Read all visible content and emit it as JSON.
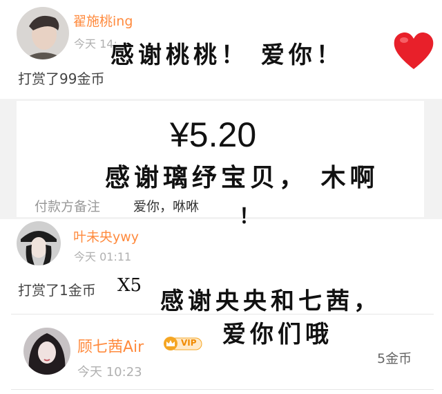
{
  "entry1": {
    "username": "翟施桃ing",
    "time": "今天 14:",
    "gift_text": "打赏了99金币",
    "caption": "感谢桃桃！ 爱你！",
    "heart_icon": "heart-icon"
  },
  "payment": {
    "amount": "¥5.20",
    "note_label": "付款方备注",
    "note_value": "爱你，咻咻",
    "caption_line1": "感谢璃纾宝贝， 木啊",
    "caption_line2": "！"
  },
  "entry2": {
    "username": "叶未央ywy",
    "time": "今天 01:11",
    "gift_text": "打赏了1金币",
    "multiplier": "X5",
    "caption_line1": "感谢央央和七茜，",
    "caption_line2": "爱你们哦"
  },
  "entry3": {
    "username": "顾七茜Air",
    "vip_label": "VIP",
    "time": "今天 10:23",
    "coins": "5金币"
  },
  "colors": {
    "username": "#ff8a3d",
    "time": "#b0b0b0",
    "panel_bg": "#f2f2f2",
    "heart": "#e8202a",
    "vip": "#f5a623"
  }
}
